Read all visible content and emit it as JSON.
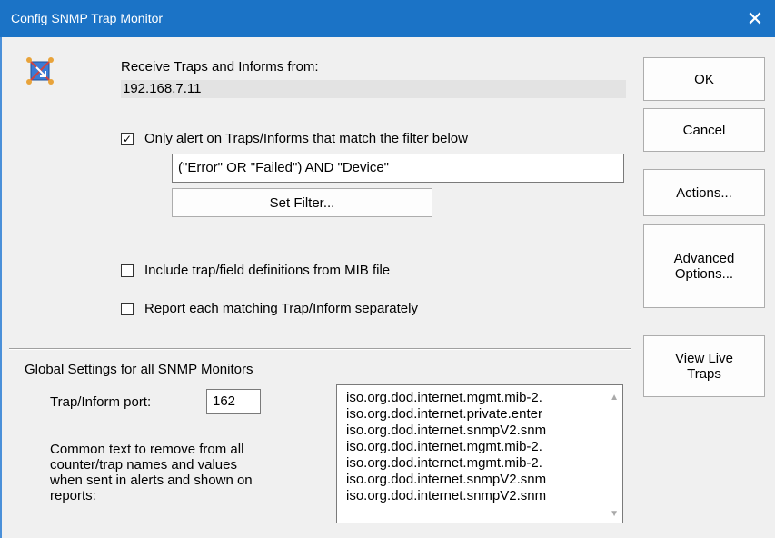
{
  "window": {
    "title": "Config SNMP Trap Monitor",
    "close_glyph": "✕"
  },
  "source": {
    "label": "Receive Traps and Informs from:",
    "value": "192.168.7.11"
  },
  "filter": {
    "checkbox_label": "Only alert on Traps/Informs that match the filter below",
    "checked": true,
    "expression": "(\"Error\" OR \"Failed\") AND \"Device\"",
    "set_filter_label": "Set Filter..."
  },
  "options": {
    "mib_label": "Include trap/field definitions from MIB file",
    "mib_checked": false,
    "separate_label": "Report each matching Trap/Inform separately",
    "separate_checked": false
  },
  "global": {
    "heading": "Global Settings for all SNMP Monitors",
    "port_label": "Trap/Inform port:",
    "port_value": "162",
    "remove_text_label": "Common text to remove from all counter/trap names and values when sent in alerts and shown on reports:",
    "remove_list": [
      "iso.org.dod.internet.mgmt.mib-2.",
      "iso.org.dod.internet.private.enter",
      "iso.org.dod.internet.snmpV2.snm",
      "iso.org.dod.internet.mgmt.mib-2.",
      "iso.org.dod.internet.mgmt.mib-2.",
      "iso.org.dod.internet.snmpV2.snm",
      "iso.org.dod.internet.snmpV2.snm"
    ]
  },
  "buttons": {
    "ok": "OK",
    "cancel": "Cancel",
    "actions": "Actions...",
    "advanced_line1": "Advanced",
    "advanced_line2": "Options...",
    "view_live_line1": "View Live",
    "view_live_line2": "Traps"
  },
  "icons": {
    "app": "network-monitor-icon",
    "check": "checkmark-icon",
    "scroll_up": "scroll-up-icon",
    "scroll_down": "scroll-down-icon"
  },
  "colors": {
    "titlebar": "#1b73c6",
    "dialog_bg": "#f0f0f0"
  }
}
